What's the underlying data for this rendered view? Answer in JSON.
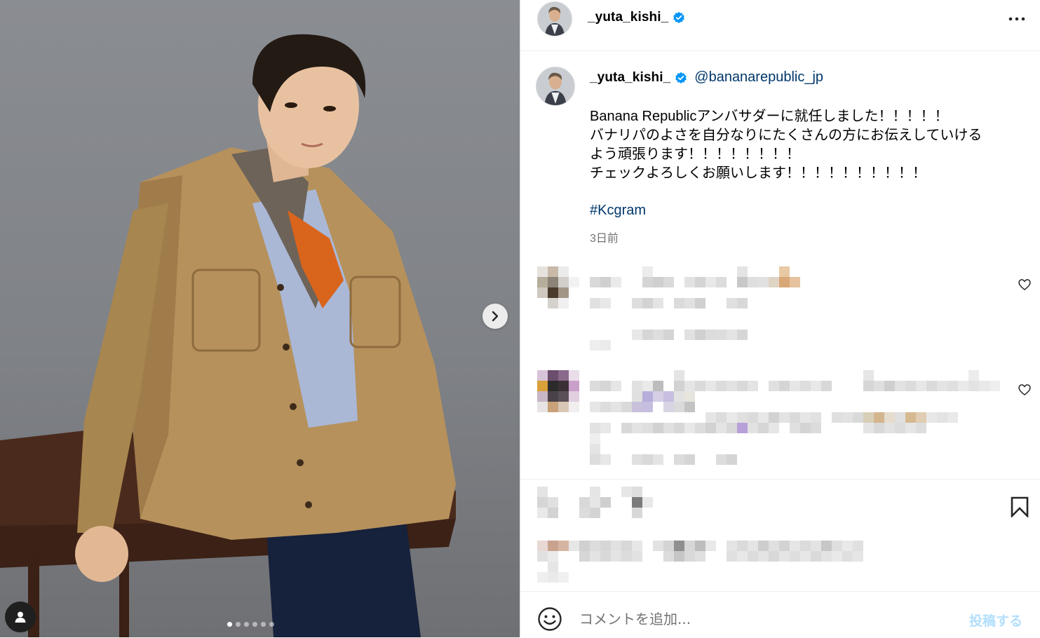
{
  "post": {
    "username": "_yuta_kishi_",
    "mention": "@bananarepublic_jp",
    "caption_lines": [
      "Banana Republicアンバサダーに就任しました！！！！！",
      "バナリパのよさを自分なりにたくさんの方にお伝えしていける",
      "よう頑張ります！！！！！！！！",
      "チェックよろしくお願いします！！！！！！！！！！"
    ],
    "hashtag": "#Kcgram",
    "timestamp": "3日前"
  },
  "icons": {
    "verified": "verified-badge-icon",
    "more": "more-options-icon",
    "heart": "heart-icon",
    "bookmark": "bookmark-icon",
    "emoji": "emoji-icon",
    "next": "chevron-right-icon",
    "tag": "user-tag-icon"
  },
  "carousel": {
    "count": 6,
    "active_index": 0
  },
  "comment_form": {
    "placeholder": "コメントを追加...",
    "post_label": "投稿する"
  },
  "colors": {
    "verified_blue": "#0095f6",
    "link": "#00376b",
    "post_button_disabled": "#b2dffc",
    "secondary_text": "#737373"
  }
}
